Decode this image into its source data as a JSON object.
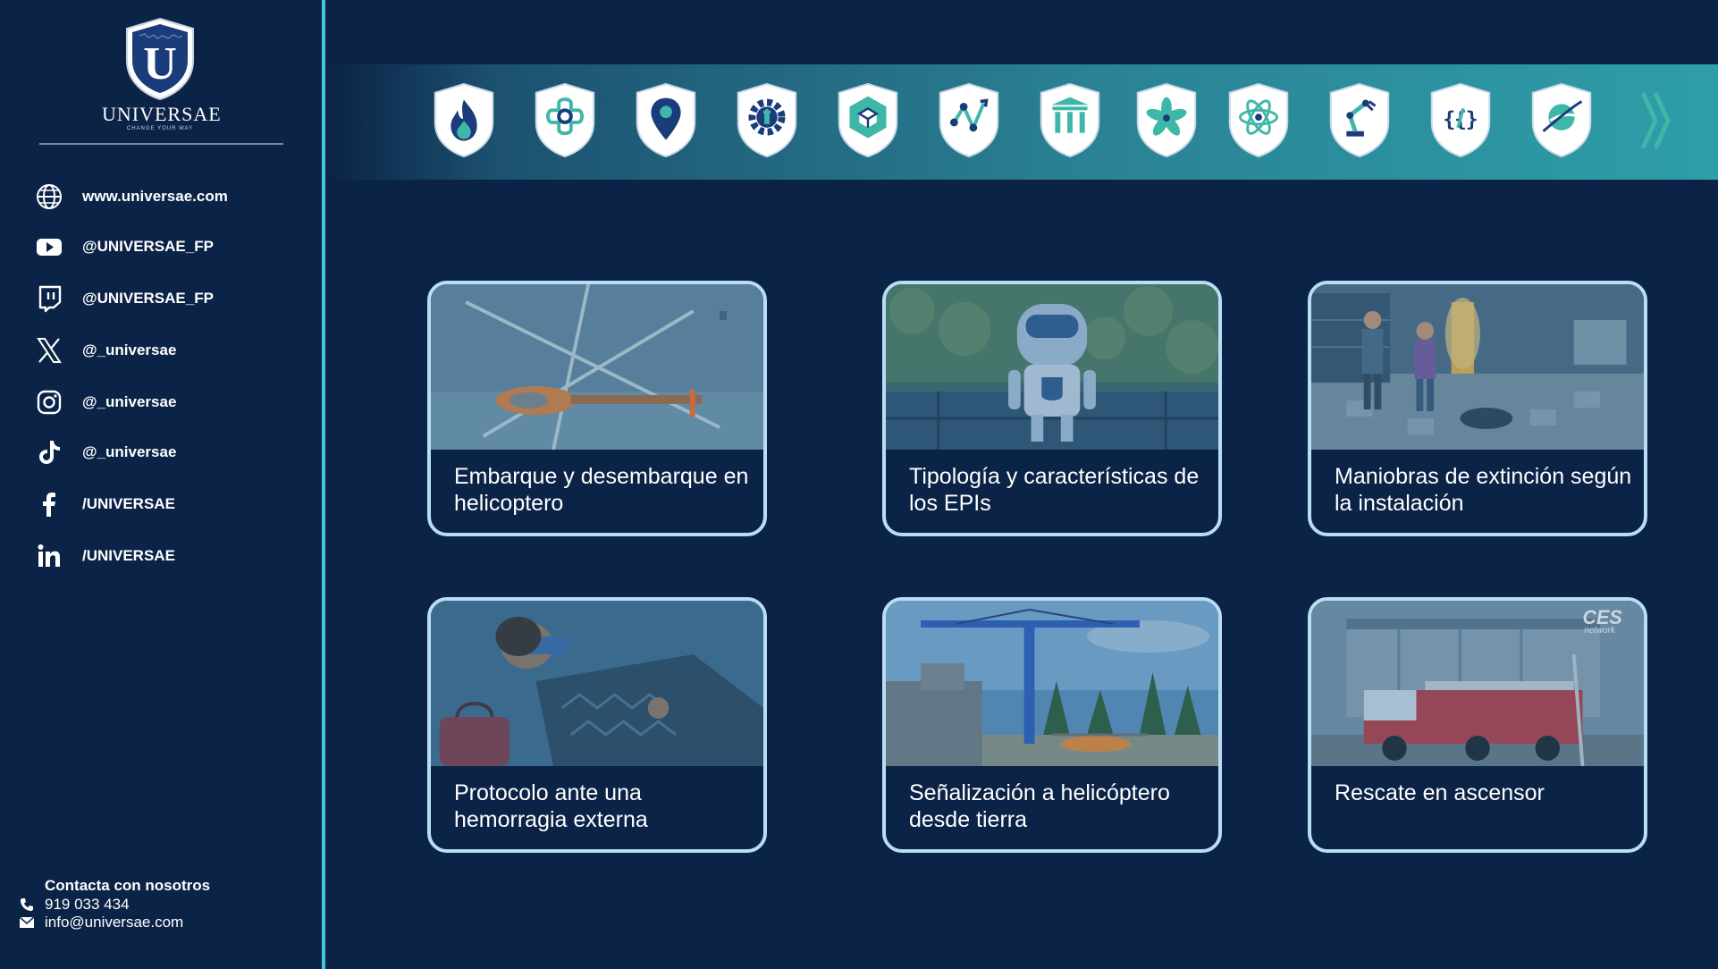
{
  "brand": {
    "name": "UNIVERSAE",
    "tagline": "CHANGE YOUR WAY",
    "logo_letter": "U"
  },
  "social": [
    {
      "icon": "globe-icon",
      "label": "www.universae.com"
    },
    {
      "icon": "youtube-icon",
      "label": "@UNIVERSAE_FP"
    },
    {
      "icon": "twitch-icon",
      "label": "@UNIVERSAE_FP"
    },
    {
      "icon": "x-icon",
      "label": "@_universae"
    },
    {
      "icon": "instagram-icon",
      "label": "@_universae"
    },
    {
      "icon": "tiktok-icon",
      "label": "@_universae"
    },
    {
      "icon": "facebook-icon",
      "label": "/UNIVERSAE"
    },
    {
      "icon": "linkedin-icon",
      "label": "/UNIVERSAE"
    }
  ],
  "contact": {
    "title": "Contacta con nosotros",
    "phone": "919 033 434",
    "email": "info@universae.com"
  },
  "categories": [
    "flame-icon",
    "medical-cross-icon",
    "location-pin-icon",
    "gear-wrench-icon",
    "cube-icon",
    "network-chart-icon",
    "columns-icon",
    "leaf-flower-icon",
    "atom-icon",
    "robot-arm-icon",
    "code-icon",
    "globe-orbit-icon"
  ],
  "cards": [
    {
      "title": "Embarque y desembarque en helicoptero",
      "scene": "helicopter"
    },
    {
      "title": "Tipología y características de los EPIs",
      "scene": "robot"
    },
    {
      "title": "Maniobras de extinción según la instalación",
      "scene": "office-fire"
    },
    {
      "title": "Protocolo ante una hemorragia externa",
      "scene": "patient"
    },
    {
      "title": "Señalización a helicóptero desde tierra",
      "scene": "crane"
    },
    {
      "title": "Rescate en ascensor",
      "scene": "fire-truck",
      "watermark": "CES",
      "watermark_sub": "network"
    }
  ],
  "colors": {
    "background": "#0b2346",
    "accent": "#3fc7e0",
    "card_border": "#b9def4",
    "icon_teal": "#3fb7a8",
    "icon_navy": "#1a3c7a"
  }
}
